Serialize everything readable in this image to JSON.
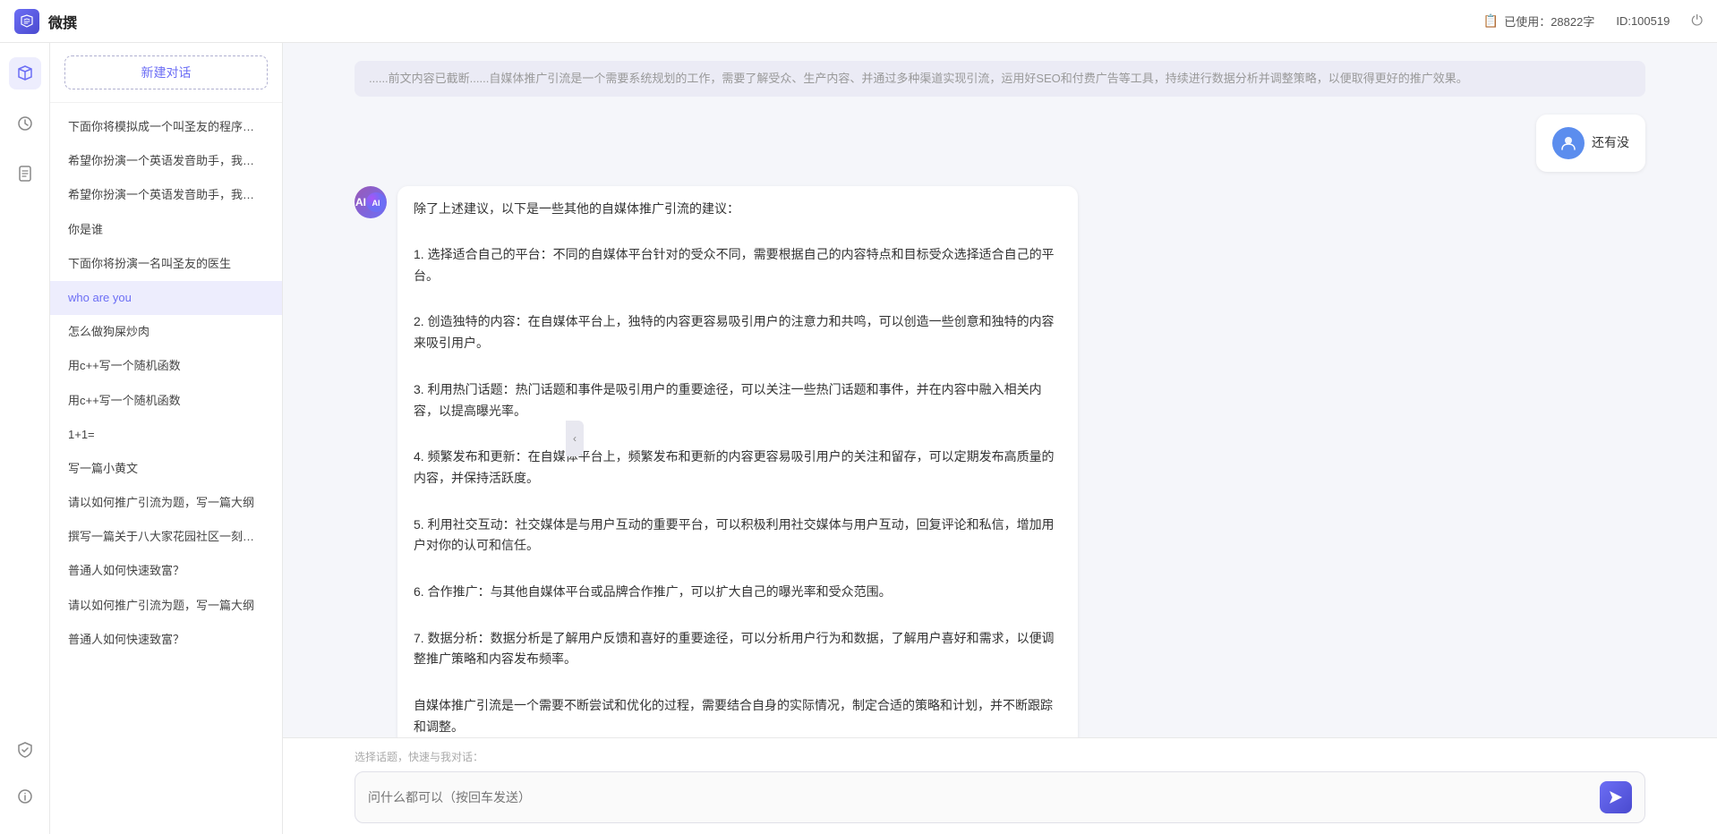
{
  "header": {
    "logo": "W",
    "title": "微撰",
    "usage_icon": "📋",
    "usage_label": "已使用：28822字",
    "id_label": "ID:100519",
    "power_icon": "⏻"
  },
  "sidebar": {
    "new_chat_label": "新建对话",
    "items": [
      {
        "id": 1,
        "label": "下面你将模拟成一个叫圣友的程序员，我说...",
        "active": false
      },
      {
        "id": 2,
        "label": "希望你扮演一个英语发音助手，我提供给你...",
        "active": false
      },
      {
        "id": 3,
        "label": "希望你扮演一个英语发音助手，我提供给你...",
        "active": false
      },
      {
        "id": 4,
        "label": "你是谁",
        "active": false
      },
      {
        "id": 5,
        "label": "下面你将扮演一名叫圣友的医生",
        "active": false
      },
      {
        "id": 6,
        "label": "who are you",
        "active": true
      },
      {
        "id": 7,
        "label": "怎么做狗屎炒肉",
        "active": false
      },
      {
        "id": 8,
        "label": "用c++写一个随机函数",
        "active": false
      },
      {
        "id": 9,
        "label": "用c++写一个随机函数",
        "active": false
      },
      {
        "id": 10,
        "label": "1+1=",
        "active": false
      },
      {
        "id": 11,
        "label": "写一篇小黄文",
        "active": false
      },
      {
        "id": 12,
        "label": "请以如何推广引流为题，写一篇大纲",
        "active": false
      },
      {
        "id": 13,
        "label": "撰写一篇关于八大家花园社区一刻钟便民生...",
        "active": false
      },
      {
        "id": 14,
        "label": "普通人如何快速致富？",
        "active": false
      },
      {
        "id": 15,
        "label": "请以如何推广引流为题，写一篇大纲",
        "active": false
      },
      {
        "id": 16,
        "label": "普通人如何快速致富？",
        "active": false
      }
    ]
  },
  "icon_bar": {
    "icons": [
      {
        "name": "box-icon",
        "symbol": "⬡",
        "active": false
      },
      {
        "name": "clock-icon",
        "symbol": "🕐",
        "active": false
      },
      {
        "name": "document-icon",
        "symbol": "📄",
        "active": false
      }
    ],
    "bottom_icons": [
      {
        "name": "shield-icon",
        "symbol": "🛡"
      },
      {
        "name": "info-icon",
        "symbol": "ℹ"
      }
    ]
  },
  "chat": {
    "truncated_text": "......",
    "messages": [
      {
        "id": 1,
        "role": "user",
        "text": "还有没"
      },
      {
        "id": 2,
        "role": "ai",
        "text": "除了上述建议，以下是一些其他的自媒体推广引流的建议：\n\n1. 选择适合自己的平台：不同的自媒体平台针对的受众不同，需要根据自己的内容特点和目标受众选择适合自己的平台。\n\n2. 创造独特的内容：在自媒体平台上，独特的内容更容易吸引用户的注意力和共鸣，可以创造一些创意和独特的内容来吸引用户。\n\n3. 利用热门话题：热门话题和事件是吸引用户的重要途径，可以关注一些热门话题和事件，并在内容中融入相关内容，以提高曝光率。\n\n4. 频繁发布和更新：在自媒体平台上，频繁发布和更新的内容更容易吸引用户的关注和留存，可以定期发布高质量的内容，并保持活跃度。\n\n5. 利用社交互动：社交媒体是与用户互动的重要平台，可以积极利用社交媒体与用户互动，回复评论和私信，增加用户对你的认可和信任。\n\n6. 合作推广：与其他自媒体平台或品牌合作推广，可以扩大自己的曝光率和受众范围。\n\n7. 数据分析：数据分析是了解用户反馈和喜好的重要途径，可以分析用户行为和数据，了解用户喜好和需求，以便调整推广策略和内容发布频率。\n\n自媒体推广引流是一个需要不断尝试和优化的过程，需要结合自身的实际情况，制定合适的策略和计划，并不断跟踪和调整。"
      }
    ],
    "input": {
      "quick_label": "选择话题，快速与我对话：",
      "placeholder": "问什么都可以（按回车发送）"
    },
    "send_icon": "➤"
  }
}
